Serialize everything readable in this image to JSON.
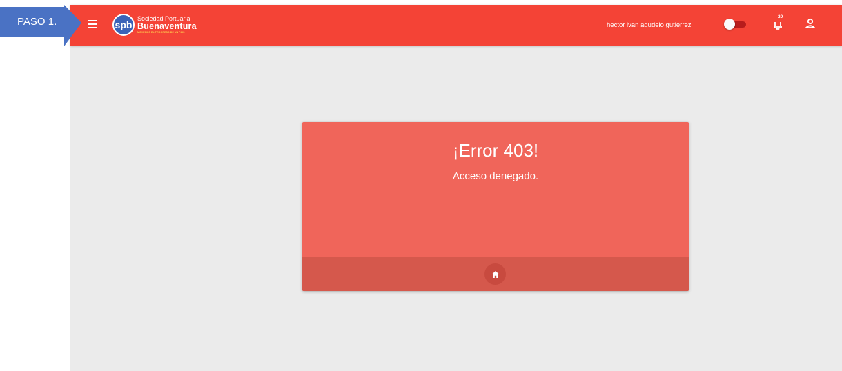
{
  "annotation": {
    "label": "PASO 1."
  },
  "header": {
    "logo": {
      "mark_text": "spb",
      "line1": "Sociedad Portuaria",
      "line2": "Buenaventura",
      "line3": "MOVEMOS EL PROGRESO DE UN PAIS"
    },
    "user_name": "hector ivan agudelo gutierrez",
    "notifications_count": "20",
    "icons": {
      "menu": "hamburger-menu-icon",
      "toggle": "theme-toggle",
      "notifications": "bell-icon",
      "account": "person-icon"
    }
  },
  "error_card": {
    "title": "¡Error 403!",
    "message": "Acceso denegado.",
    "home_icon": "home-icon"
  },
  "colors": {
    "header": "#f44336",
    "card": "#f0655a",
    "card_footer": "#d5584c",
    "background": "#ebebeb",
    "annotation_arrow": "#4a72c4"
  }
}
